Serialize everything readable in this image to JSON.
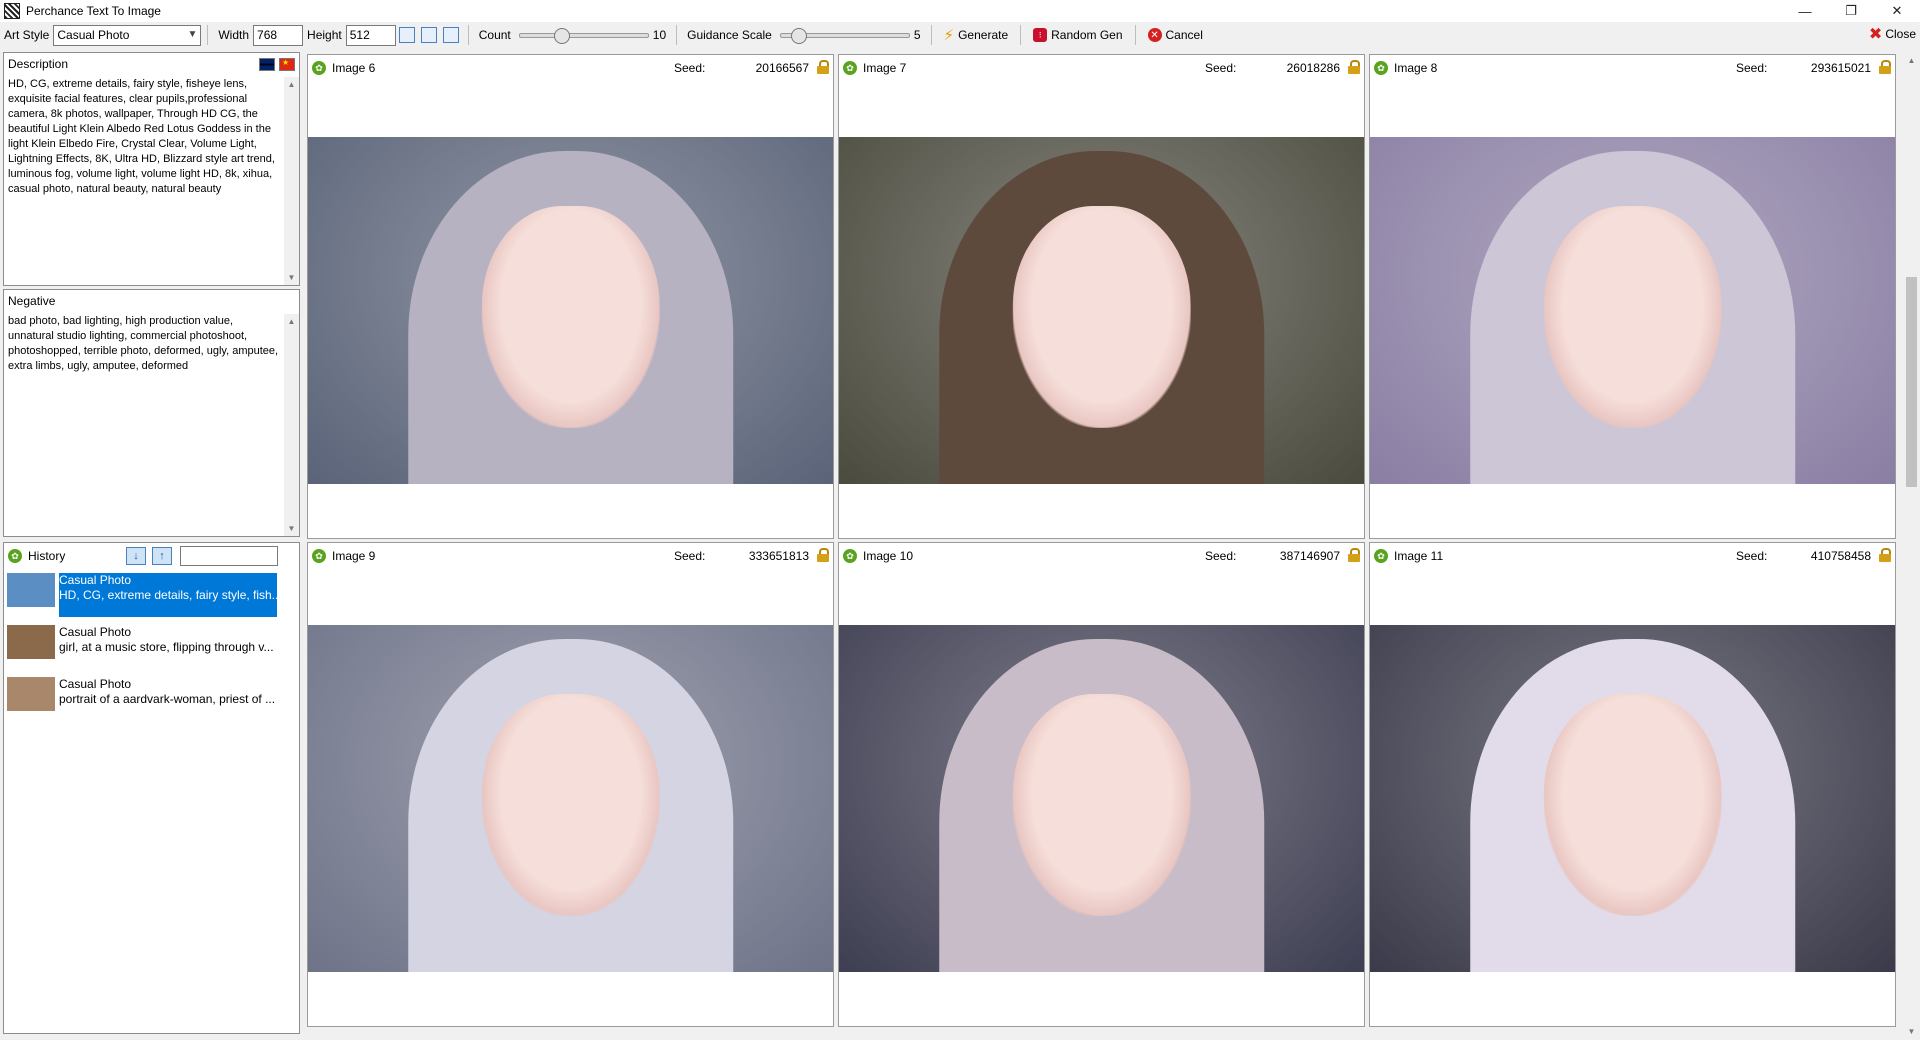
{
  "window": {
    "title": "Perchance Text To Image"
  },
  "toolbar": {
    "art_style_label": "Art Style",
    "art_style_value": "Casual Photo",
    "width_label": "Width",
    "width_value": "768",
    "height_label": "Height",
    "height_value": "512",
    "count_label": "Count",
    "count_value": "10",
    "count_fraction": 0.33,
    "guidance_label": "Guidance Scale",
    "guidance_value": "5",
    "guidance_fraction": 0.15,
    "generate_label": "Generate",
    "random_gen_label": "Random Gen",
    "cancel_label": "Cancel",
    "close_label": "Close"
  },
  "description": {
    "title": "Description",
    "text": "HD, CG, extreme details, fairy style, fisheye lens, exquisite facial features, clear pupils,professional camera, 8k photos, wallpaper, Through HD CG, the beautiful Light Klein Albedo Red Lotus Goddess in the light Klein Elbedo Fire, Crystal Clear, Volume Light, Lightning Effects, 8K, Ultra HD, Blizzard style art trend, luminous fog, volume light, volume light HD, 8k, xihua, casual photo, natural beauty, natural beauty"
  },
  "negative": {
    "title": "Negative",
    "text": "bad photo, bad lighting, high production value, unnatural studio lighting, commercial photoshoot, photoshopped, terrible photo, deformed, ugly, amputee, extra limbs, ugly, amputee, deformed"
  },
  "history": {
    "title": "History",
    "items": [
      {
        "style": "Casual Photo",
        "prompt": "HD, CG, extreme details, fairy style, fish...",
        "thumb_color": "#5b8fc4"
      },
      {
        "style": "Casual Photo",
        "prompt": "girl, at a music store, flipping through v...",
        "thumb_color": "#8a6a4a"
      },
      {
        "style": "Casual Photo",
        "prompt": "portrait of a aardvark-woman, priest of ...",
        "thumb_color": "#a8876a"
      }
    ]
  },
  "images": [
    {
      "title": "Image 6",
      "seed_label": "Seed:",
      "seed": "20166567",
      "bg": "#5a6378",
      "hair": "#b6b2c2"
    },
    {
      "title": "Image 7",
      "seed_label": "Seed:",
      "seed": "26018286",
      "bg": "#4a4a3e",
      "hair": "#5e4a3c"
    },
    {
      "title": "Image 8",
      "seed_label": "Seed:",
      "seed": "293615021",
      "bg": "#8a7ea3",
      "hair": "#ccc6d6"
    },
    {
      "title": "Image 9",
      "seed_label": "Seed:",
      "seed": "333651813",
      "bg": "#6e7388",
      "hair": "#d4d4e2"
    },
    {
      "title": "Image 10",
      "seed_label": "Seed:",
      "seed": "387146907",
      "bg": "#3e3e52",
      "hair": "#c8bcc8"
    },
    {
      "title": "Image 11",
      "seed_label": "Seed:",
      "seed": "410758458",
      "bg": "#3a3a4a",
      "hair": "#e2dcea"
    }
  ]
}
